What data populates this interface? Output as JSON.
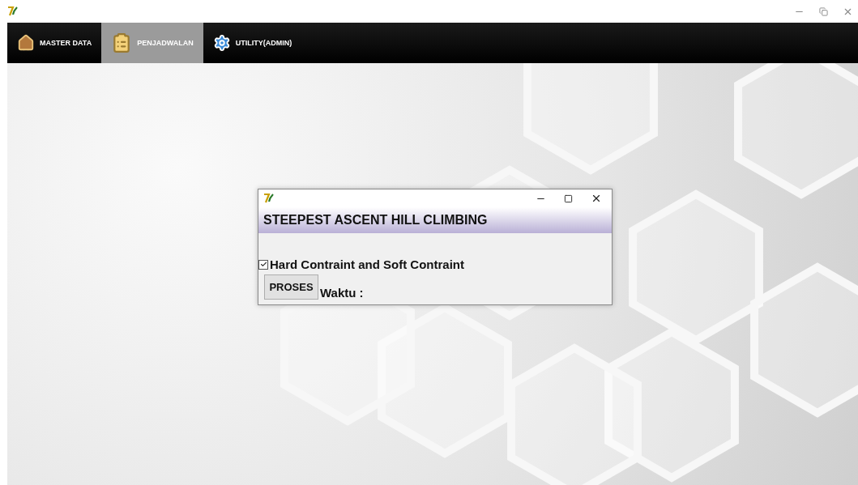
{
  "menu": {
    "items": [
      {
        "label": "MASTER DATA",
        "kind": "house",
        "selected": false
      },
      {
        "label": "PENJADWALAN",
        "kind": "clipboard",
        "selected": true
      },
      {
        "label": "UTILITY(ADMIN)",
        "kind": "gear",
        "selected": false
      }
    ]
  },
  "dialog": {
    "heading": "STEEPEST ASCENT HILL CLIMBING",
    "checkbox": {
      "label": "Hard Contraint and Soft Contraint",
      "checked": true
    },
    "button": "PROSES",
    "time_label": "Waktu :"
  }
}
